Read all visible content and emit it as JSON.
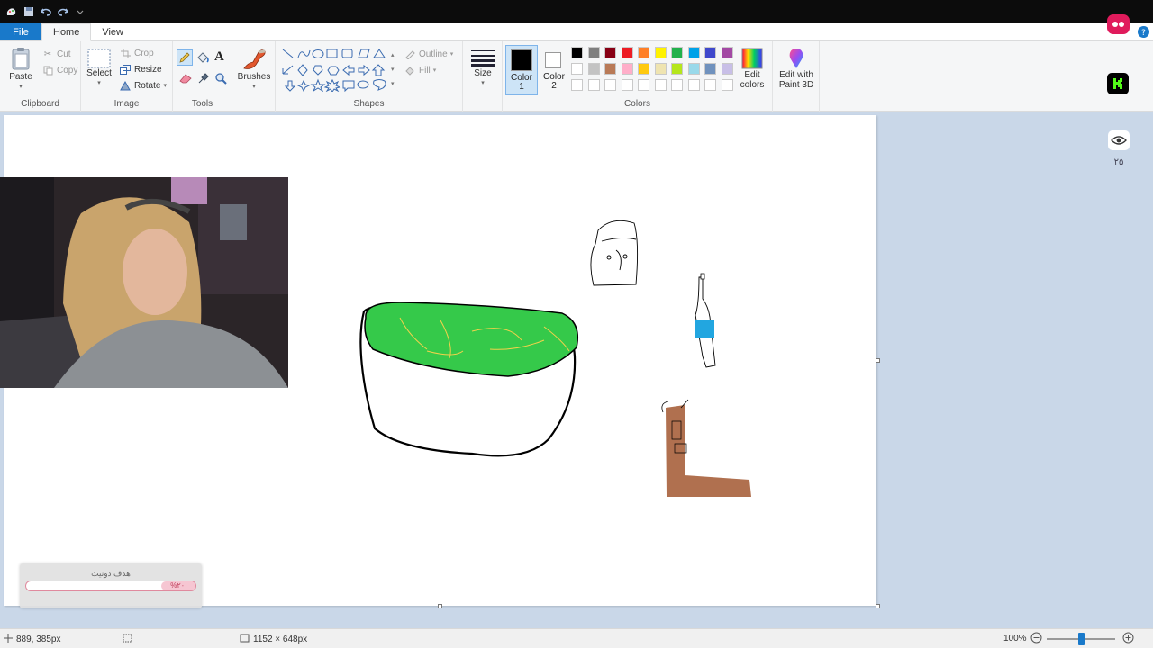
{
  "tabs": {
    "file": "File",
    "home": "Home",
    "view": "View"
  },
  "clipboard": {
    "label": "Clipboard",
    "paste": "Paste",
    "cut": "Cut",
    "copy": "Copy"
  },
  "image": {
    "label": "Image",
    "select": "Select",
    "crop": "Crop",
    "resize": "Resize",
    "rotate": "Rotate"
  },
  "tools": {
    "label": "Tools",
    "text_tool": "A"
  },
  "brushes": {
    "label": "Brushes"
  },
  "shapes": {
    "label": "Shapes",
    "outline": "Outline",
    "fill": "Fill"
  },
  "size": {
    "label": "Size"
  },
  "color1": {
    "label_line1": "Color",
    "label_line2": "1",
    "value": "#000000"
  },
  "color2": {
    "label_line1": "Color",
    "label_line2": "2",
    "value": "#ffffff"
  },
  "colors": {
    "label": "Colors",
    "row1": [
      "#000000",
      "#7f7f7f",
      "#880015",
      "#ed1c24",
      "#ff7f27",
      "#fff200",
      "#22b14c",
      "#00a2e8",
      "#3f48cc",
      "#a349a4"
    ],
    "row2": [
      "#ffffff",
      "#c3c3c3",
      "#b97a57",
      "#ffaec9",
      "#ffc90e",
      "#efe4b0",
      "#b5e61d",
      "#99d9ea",
      "#7092be",
      "#c8bfe7"
    ],
    "row3": [
      "#ffffff",
      "#ffffff",
      "#ffffff",
      "#ffffff",
      "#ffffff",
      "#ffffff",
      "#ffffff",
      "#ffffff",
      "#ffffff",
      "#ffffff"
    ]
  },
  "edit_colors": {
    "line1": "Edit",
    "line2": "colors"
  },
  "paint3d": {
    "line1": "Edit with",
    "line2": "Paint 3D"
  },
  "stream_overlay": {
    "viewer_count": "۲۵",
    "donation_title": "هدف دونیت",
    "donation_percent": "%۲۰",
    "donation_progress": 0.2
  },
  "status": {
    "cursor_pos": "889, 385px",
    "canvas_size": "1152 × 648px",
    "zoom": "100%",
    "zoom_value": 100
  },
  "accent": "#1979ca"
}
